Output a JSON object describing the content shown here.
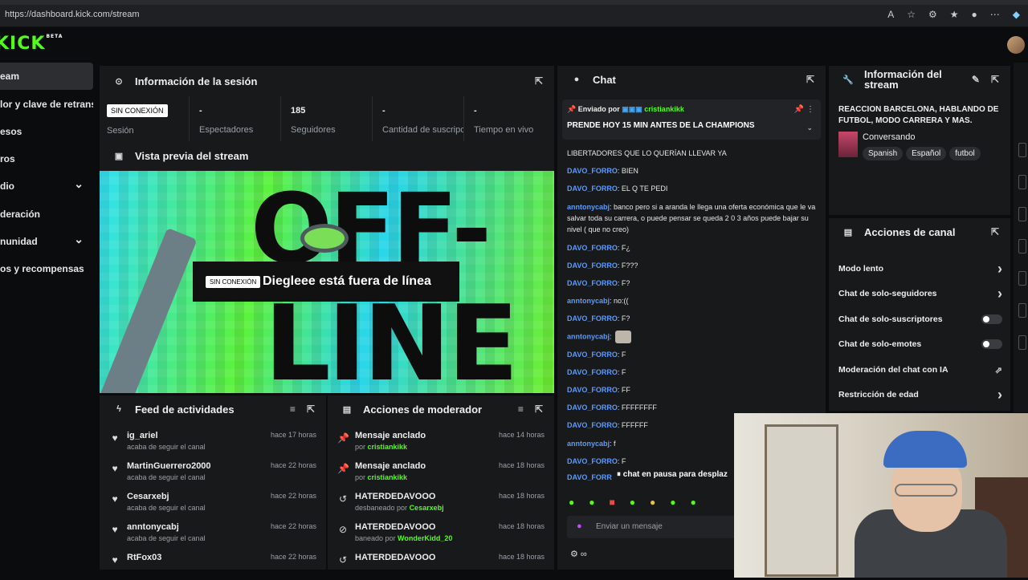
{
  "browser": {
    "url": "https://dashboard.kick.com/stream"
  },
  "logo": {
    "text": "KICK",
    "badge": "BETA"
  },
  "sidebar": {
    "items": [
      {
        "label": "eam",
        "active": true,
        "chevron": false
      },
      {
        "label": "lor y clave de retransmisión",
        "active": false,
        "chevron": false
      },
      {
        "label": "esos",
        "active": false,
        "chevron": false
      },
      {
        "label": "ros",
        "active": false,
        "chevron": false
      },
      {
        "label": "dio",
        "active": false,
        "chevron": true
      },
      {
        "label": "deración",
        "active": false,
        "chevron": false
      },
      {
        "label": "nunidad",
        "active": false,
        "chevron": true
      },
      {
        "label": "os y recompensas",
        "active": false,
        "chevron": false
      }
    ]
  },
  "session": {
    "title": "Información de la sesión",
    "status_badge": "SIN CONEXIÓN",
    "status_label": "Sesión",
    "stats": [
      {
        "value": "-",
        "label": "Espectadores"
      },
      {
        "value": "185",
        "label": "Seguidores"
      },
      {
        "value": "-",
        "label": "Cantidad de suscripciones"
      },
      {
        "value": "-",
        "label": "Tiempo en vivo"
      }
    ]
  },
  "preview": {
    "title": "Vista previa del stream",
    "badge": "SIN CONEXIÓN",
    "message": "Diegleee está fuera de línea",
    "art_top": "OFF-",
    "art_bottom": "LINE"
  },
  "feed": {
    "title": "Feed de actividades",
    "items": [
      {
        "name": "ig_ariel",
        "sub": "acaba de seguir el canal",
        "time": "hace 17 horas"
      },
      {
        "name": "MartinGuerrero2000",
        "sub": "acaba de seguir el canal",
        "time": "hace 22 horas"
      },
      {
        "name": "Cesarxebj",
        "sub": "acaba de seguir el canal",
        "time": "hace 22 horas"
      },
      {
        "name": "anntonycabj",
        "sub": "acaba de seguir el canal",
        "time": "hace 22 horas"
      },
      {
        "name": "RtFox03",
        "sub": "",
        "time": "hace 22 horas"
      }
    ]
  },
  "mod": {
    "title": "Acciones de moderador",
    "items": [
      {
        "icon": "pin-icon",
        "glyph": "📌",
        "name": "Mensaje anclado",
        "pre": "por ",
        "who": "cristiankikk",
        "time": "hace 14 horas"
      },
      {
        "icon": "pin-icon",
        "glyph": "📌",
        "name": "Mensaje anclado",
        "pre": "por ",
        "who": "cristiankikk",
        "time": "hace 18 horas"
      },
      {
        "icon": "undo-icon",
        "glyph": "↺",
        "name": "HATERDEDAVOOO",
        "pre": "desbaneado por ",
        "who": "Cesarxebj",
        "time": "hace 18 horas"
      },
      {
        "icon": "ban-icon",
        "glyph": "⊘",
        "name": "HATERDEDAVOOO",
        "pre": "baneado por ",
        "who": "WonderKidd_20",
        "time": "hace 18 horas"
      },
      {
        "icon": "undo-icon",
        "glyph": "↺",
        "name": "HATERDEDAVOOO",
        "pre": "",
        "who": "",
        "time": "hace 18 horas"
      }
    ]
  },
  "chat": {
    "title": "Chat",
    "pinned": {
      "sent_by": "Enviado por",
      "user": "cristiankikk",
      "text": "PRENDE HOY 15 MIN ANTES DE LA CHAMPIONS"
    },
    "messages": [
      {
        "user": "",
        "text": "LIBERTADORES QUE LO QUERÍAN LLEVAR YA",
        "color": "#5b9bff"
      },
      {
        "user": "DAVO_FORRO",
        "text": "BIEN",
        "color": "#5b9bff"
      },
      {
        "user": "DAVO_FORRO",
        "text": "EL Q TE PEDI",
        "color": "#5b9bff"
      },
      {
        "user": "anntonycabj",
        "text": "banco pero si a aranda le llega una oferta económica que le va salvar toda su carrera, o puede pensar se queda 2 0 3 años puede bajar su nivel ( que no creo)",
        "color": "#5b9bff"
      },
      {
        "user": "DAVO_FORRO",
        "text": "F¿",
        "color": "#5b9bff"
      },
      {
        "user": "DAVO_FORRO",
        "text": "F???",
        "color": "#5b9bff"
      },
      {
        "user": "DAVO_FORRO",
        "text": "F?",
        "color": "#5b9bff"
      },
      {
        "user": "anntonycabj",
        "text": "no:((",
        "color": "#5b9bff"
      },
      {
        "user": "DAVO_FORRO",
        "text": "F?",
        "color": "#5b9bff"
      },
      {
        "user": "anntonycabj",
        "text": "",
        "color": "#5b9bff"
      },
      {
        "user": "DAVO_FORRO",
        "text": "F",
        "color": "#5b9bff"
      },
      {
        "user": "DAVO_FORRO",
        "text": "F",
        "color": "#5b9bff"
      },
      {
        "user": "DAVO_FORRO",
        "text": "FF",
        "color": "#5b9bff"
      },
      {
        "user": "DAVO_FORRO",
        "text": "FFFFFFFF",
        "color": "#5b9bff"
      },
      {
        "user": "DAVO_FORRO",
        "text": "FFFFFF",
        "color": "#5b9bff"
      },
      {
        "user": "anntonycabj",
        "text": "f",
        "color": "#5b9bff"
      },
      {
        "user": "DAVO_FORRO",
        "text": "F",
        "color": "#5b9bff"
      }
    ],
    "partial_user": "DAVO_FORR",
    "paused": "chat en pausa para desplaz",
    "input_placeholder": "Enviar un mensaje"
  },
  "streaminfo": {
    "title": "Información del stream",
    "stream_title": "REACCION BARCELONA, HABLANDO DE FUTBOL, MODO CARRERA Y MAS.",
    "category": "Conversando",
    "tags": [
      "Spanish",
      "Español",
      "futbol"
    ]
  },
  "channel_actions": {
    "title": "Acciones de canal",
    "items": [
      {
        "label": "Modo lento",
        "control": "chevron"
      },
      {
        "label": "Chat de solo-seguidores",
        "control": "chevron"
      },
      {
        "label": "Chat de solo-suscriptores",
        "control": "toggle"
      },
      {
        "label": "Chat de solo-emotes",
        "control": "toggle"
      },
      {
        "label": "Moderación del chat con IA",
        "control": "external"
      },
      {
        "label": "Restricción de edad",
        "control": "chevron"
      }
    ]
  },
  "colors": {
    "accent": "#53fc18",
    "panel": "#18191b",
    "bg": "#0b0c0d",
    "username": "#5b9bff"
  }
}
